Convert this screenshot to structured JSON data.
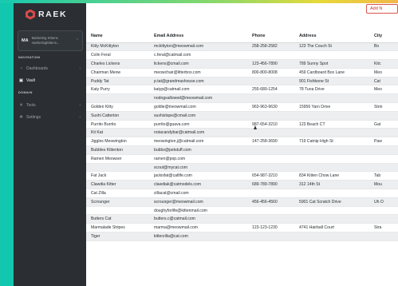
{
  "app": {
    "logo_text": "RAEK",
    "account": {
      "badge": "MA",
      "line1": "Marketing Kittens",
      "line2": "marketingkittens..."
    },
    "nav": {
      "navigation_title": "NAVIGATION",
      "domain_title": "DOMAIN",
      "items": [
        {
          "label": "Dashboards",
          "icon": "pie-chart-icon"
        },
        {
          "label": "Vault",
          "icon": "lock-icon"
        },
        {
          "label": "Tools",
          "icon": "wrench-icon"
        },
        {
          "label": "Settings",
          "icon": "gear-icon"
        }
      ]
    },
    "add_button": "Add N"
  },
  "table": {
    "headers": [
      "Name",
      "Email Address",
      "Phone",
      "Address",
      "City"
    ],
    "rows": [
      [
        "Kitty McKittyton",
        "mckittyton@meowmail.com",
        "258-258-2582",
        "123 The Couch St",
        "Bo"
      ],
      [
        "Colin Feral",
        "c.feral@catmail.com",
        "",
        "",
        ""
      ],
      [
        "Charles Lickens",
        "lickens@cmail.com",
        "123-456-7890",
        "789 Sunny Spot",
        "Kitc"
      ],
      [
        "Chairman Meow",
        "meowchair@litterbox.com",
        "800-800-8008",
        "459 Cardboard Box Lane",
        "Meo"
      ],
      [
        "Puddy Tat",
        "p.tat@grandmashouse.com",
        "",
        "901 Fishbone St",
        "Cat"
      ],
      [
        "Katy Purry",
        "katyp@catmail.com",
        "255-689-1254",
        "78 Tuna Drive",
        "Meo"
      ],
      [
        "",
        "nodogsallowed@meowmail.com",
        "",
        "",
        ""
      ],
      [
        "Golden Kitty",
        "goldie@meowmail.com",
        "963-963-9630",
        "15956 Yarn Drive",
        "Strin"
      ],
      [
        "Sushi Catterton",
        "sushislope@cmail.com",
        "",
        "",
        ""
      ],
      [
        "Purrito Burrito",
        "purrito@guava.com",
        "987-654-3210",
        "123 Beach CT",
        "Gat"
      ],
      [
        "Kit Kat",
        "notacandybar@catmail.com",
        "",
        "",
        ""
      ],
      [
        "Jiggles Meowington",
        "meowington.j@catmail.com",
        "147-258-3690",
        "719 Catnip High St",
        "Paw"
      ],
      [
        "Bubbles Kittenton",
        "bubbs@petstuff.com",
        "",
        "",
        ""
      ],
      [
        "Ramen Meowser",
        "ramen@pop.com",
        "",
        "",
        ""
      ],
      [
        "",
        "scout@mycat.com",
        "",
        "",
        ""
      ],
      [
        "Fat Jack",
        "jackisfat@catlife.com",
        "654-987-3210",
        "834 Kitten Chow Lane",
        "Tab"
      ],
      [
        "Clawdia Kitter",
        "clawdiak@catmodels.com",
        "689-789-7890",
        "312 14th St",
        "Mou"
      ],
      [
        "Cat Zilla",
        "zillacat@cmail.com",
        "",
        "",
        ""
      ],
      [
        "Scrounger",
        "scrounger@meowmail.com",
        "456-456-4560",
        "5901 Cat Scratch Drive",
        "Uh O"
      ],
      [
        "",
        "doughyforlife@kittenmail.com",
        "",
        "",
        ""
      ],
      [
        "Butters Cat",
        "butters.c@catmail.com",
        "",
        "",
        ""
      ],
      [
        "Marmalade Stripes",
        "marma@meowmail.com",
        "123-123-1230",
        "4741 Hairball Court",
        "Stra"
      ],
      [
        "Tiger",
        "kitterzilla@cat.com",
        "",
        "",
        ""
      ]
    ]
  }
}
